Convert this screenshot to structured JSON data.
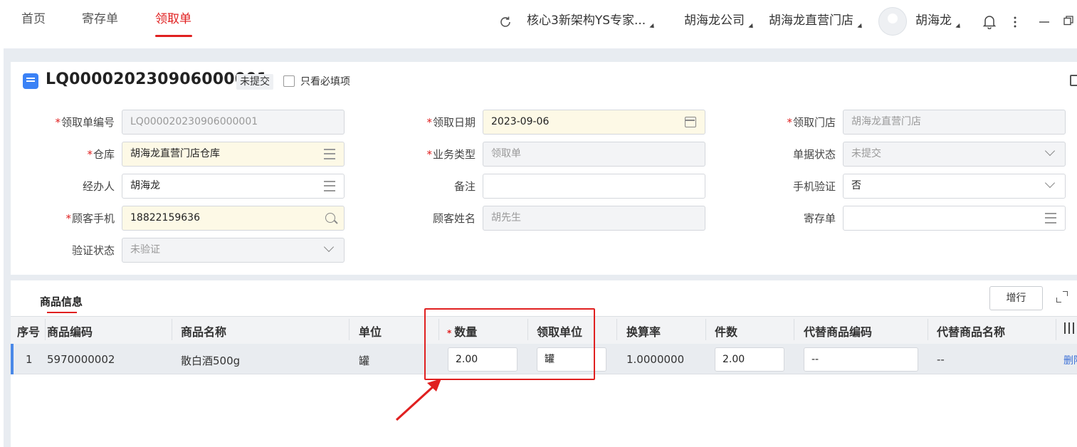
{
  "topbar": {
    "tabs": [
      {
        "label": "首页",
        "active": false
      },
      {
        "label": "寄存单",
        "active": false
      },
      {
        "label": "领取单",
        "active": true
      }
    ],
    "org": "核心3新架构YS专家...",
    "company": "胡海龙公司",
    "store": "胡海龙直营门店",
    "user": "胡海龙",
    "icons": [
      "refresh-icon",
      "bell-icon",
      "more-vertical-icon",
      "minimize-icon",
      "restore-icon"
    ]
  },
  "header": {
    "doc_id": "LQ000020230906000001",
    "status": "未提交",
    "only_required_label": "只看必填项"
  },
  "form": {
    "pickup_no": {
      "label": "领取单编号",
      "value": "LQ000020230906000001",
      "required": true
    },
    "pickup_date": {
      "label": "领取日期",
      "value": "2023-09-06",
      "required": true
    },
    "pickup_store": {
      "label": "领取门店",
      "value": "胡海龙直营门店",
      "required": true
    },
    "warehouse": {
      "label": "仓库",
      "value": "胡海龙直营门店仓库",
      "required": true
    },
    "biz_type": {
      "label": "业务类型",
      "value": "领取单",
      "required": true
    },
    "doc_status": {
      "label": "单据状态",
      "value": "未提交",
      "required": false
    },
    "handler": {
      "label": "经办人",
      "value": "胡海龙",
      "required": false
    },
    "remark": {
      "label": "备注",
      "value": "",
      "required": false
    },
    "phone_verify": {
      "label": "手机验证",
      "value": "否",
      "required": false
    },
    "customer_phone": {
      "label": "顾客手机",
      "value": "18822159636",
      "required": true
    },
    "customer_name": {
      "label": "顾客姓名",
      "value": "胡先生",
      "required": false
    },
    "deposit_doc": {
      "label": "寄存单",
      "value": "",
      "required": false
    },
    "verify_status": {
      "label": "验证状态",
      "value": "未验证",
      "required": false
    }
  },
  "products": {
    "tab_label": "商品信息",
    "add_row_label": "增行",
    "columns": [
      "序号",
      "商品编码",
      "商品名称",
      "单位",
      "数量",
      "领取单位",
      "换算率",
      "件数",
      "代替商品编码",
      "代替商品名称"
    ],
    "rows": [
      {
        "index": "1",
        "code": "5970000002",
        "name": "散白酒500g",
        "unit": "罐",
        "qty": "2.00",
        "pickup_unit": "罐",
        "rate": "1.0000000",
        "pieces": "2.00",
        "alt_code": "--",
        "alt_name": "--",
        "action": "删除"
      }
    ]
  }
}
